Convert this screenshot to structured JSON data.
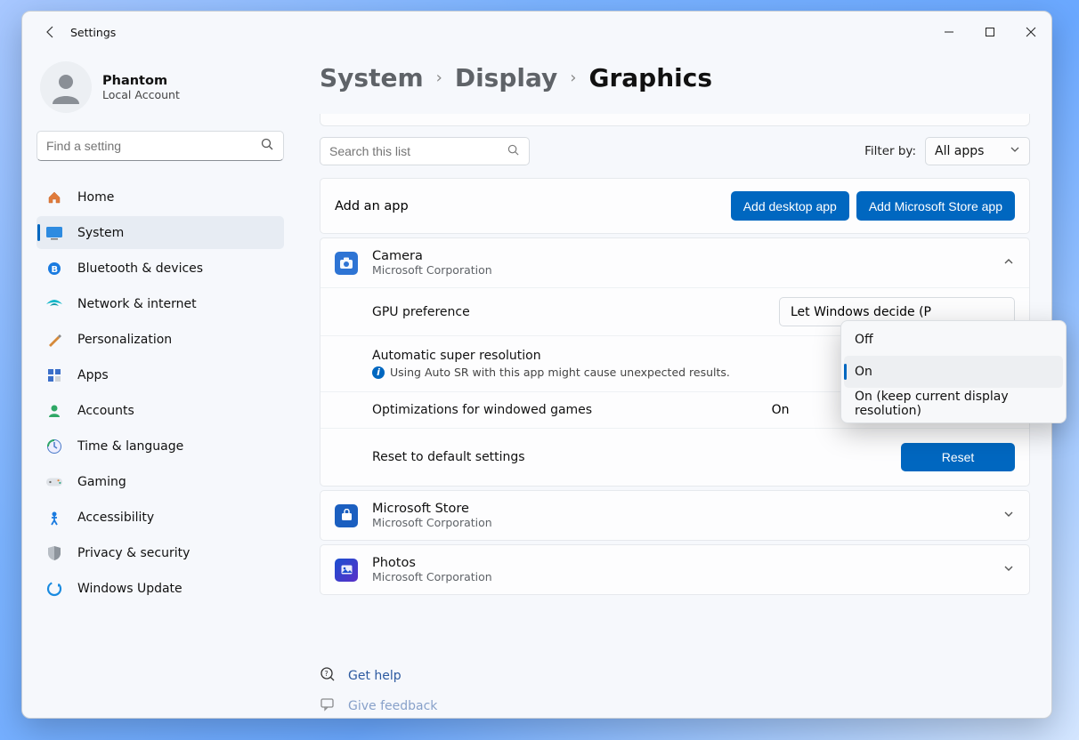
{
  "window": {
    "title": "Settings"
  },
  "profile": {
    "name": "Phantom",
    "subtitle": "Local Account"
  },
  "sidebar_search": {
    "placeholder": "Find a setting"
  },
  "nav": {
    "items": [
      {
        "label": "Home"
      },
      {
        "label": "System"
      },
      {
        "label": "Bluetooth & devices"
      },
      {
        "label": "Network & internet"
      },
      {
        "label": "Personalization"
      },
      {
        "label": "Apps"
      },
      {
        "label": "Accounts"
      },
      {
        "label": "Time & language"
      },
      {
        "label": "Gaming"
      },
      {
        "label": "Accessibility"
      },
      {
        "label": "Privacy & security"
      },
      {
        "label": "Windows Update"
      }
    ],
    "active_index": 1
  },
  "breadcrumb": {
    "a": "System",
    "b": "Display",
    "c": "Graphics"
  },
  "list_search": {
    "placeholder": "Search this list"
  },
  "filter": {
    "label": "Filter by:",
    "value": "All apps"
  },
  "add": {
    "title": "Add an app",
    "desktop_btn": "Add desktop app",
    "store_btn": "Add Microsoft Store app"
  },
  "apps": [
    {
      "name": "Camera",
      "publisher": "Microsoft Corporation",
      "expanded": true,
      "icon_color": "#2e74d4"
    },
    {
      "name": "Microsoft Store",
      "publisher": "Microsoft Corporation",
      "expanded": false,
      "icon_color": "#1b5fc0"
    },
    {
      "name": "Photos",
      "publisher": "Microsoft Corporation",
      "expanded": false,
      "icon_color": "#1a4fd0"
    }
  ],
  "expanded": {
    "gpu_label": "GPU preference",
    "gpu_value": "Let Windows decide (P",
    "asr_label": "Automatic super resolution",
    "asr_note": "Using Auto SR with this app might cause unexpected results.",
    "owg_label": "Optimizations for windowed games",
    "owg_state": "On",
    "reset_label": "Reset to default settings",
    "reset_btn": "Reset"
  },
  "menu": {
    "items": [
      "Off",
      "On",
      "On (keep current display resolution)"
    ],
    "selected_index": 1
  },
  "help": {
    "get_help": "Get help",
    "feedback": "Give feedback"
  }
}
